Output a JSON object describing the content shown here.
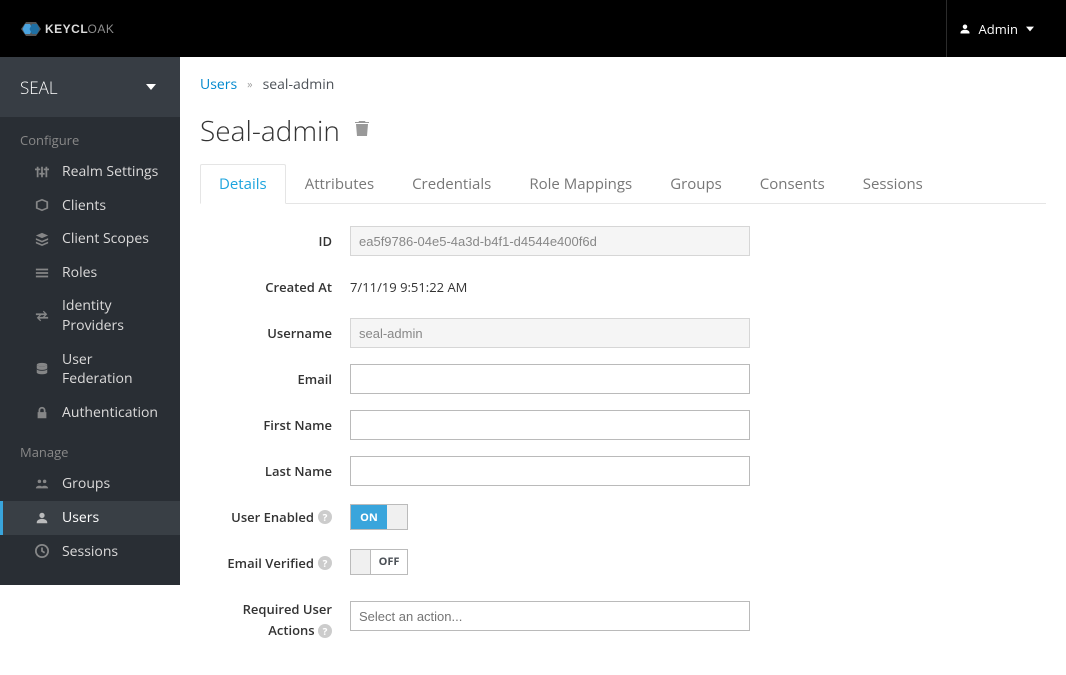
{
  "topbar": {
    "admin_label": "Admin"
  },
  "sidebar": {
    "realm_name": "SEAL",
    "section_configure": "Configure",
    "section_manage": "Manage",
    "items_configure": [
      {
        "label": "Realm Settings"
      },
      {
        "label": "Clients"
      },
      {
        "label": "Client Scopes"
      },
      {
        "label": "Roles"
      },
      {
        "label": "Identity Providers"
      },
      {
        "label": "User Federation"
      },
      {
        "label": "Authentication"
      }
    ],
    "items_manage": [
      {
        "label": "Groups"
      },
      {
        "label": "Users"
      },
      {
        "label": "Sessions"
      }
    ]
  },
  "breadcrumb": {
    "link_users": "Users",
    "current": "seal-admin"
  },
  "page": {
    "title": "Seal-admin"
  },
  "tabs": [
    {
      "label": "Details",
      "active": true
    },
    {
      "label": "Attributes"
    },
    {
      "label": "Credentials"
    },
    {
      "label": "Role Mappings"
    },
    {
      "label": "Groups"
    },
    {
      "label": "Consents"
    },
    {
      "label": "Sessions"
    }
  ],
  "form": {
    "id_label": "ID",
    "id_value": "ea5f9786-04e5-4a3d-b4f1-d4544e400f6d",
    "created_label": "Created At",
    "created_value": "7/11/19 9:51:22 AM",
    "username_label": "Username",
    "username_value": "seal-admin",
    "email_label": "Email",
    "email_value": "",
    "firstname_label": "First Name",
    "firstname_value": "",
    "lastname_label": "Last Name",
    "lastname_value": "",
    "user_enabled_label": "User Enabled",
    "user_enabled_on": "ON",
    "email_verified_label": "Email Verified",
    "email_verified_off": "OFF",
    "required_actions_label_l1": "Required User",
    "required_actions_label_l2": "Actions",
    "required_actions_placeholder": "Select an action..."
  }
}
